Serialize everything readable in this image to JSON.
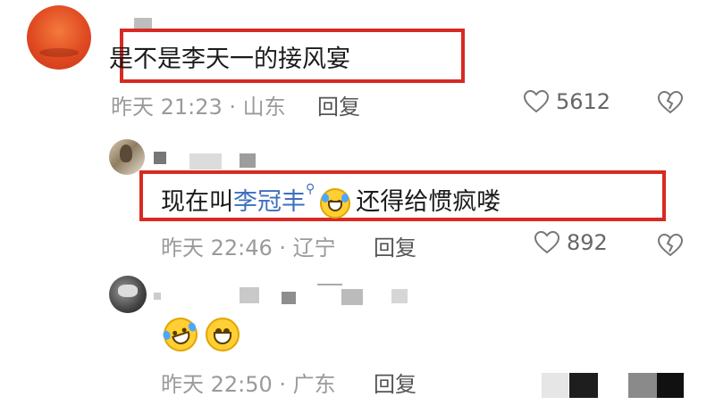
{
  "comments": [
    {
      "text": "是不是李天一的接风宴",
      "meta": "昨天 21:23 · 山东",
      "reply_label": "回复",
      "likes": "5612"
    },
    {
      "text_before": "现在叫",
      "mention": "李冠丰",
      "text_after": "还得给惯疯喽",
      "meta": "昨天 22:46 · 辽宁",
      "reply_label": "回复",
      "likes": "892"
    },
    {
      "emojis": [
        "laughing-tears",
        "grinning"
      ],
      "meta": "昨天 22:50 · 广东",
      "reply_label": "回复"
    }
  ],
  "colors": {
    "highlight_box": "#d82a22",
    "mention": "#3d6fbf",
    "meta_text": "#9a9a9a"
  },
  "icons": {
    "like": "heart-outline-icon",
    "dislike": "broken-heart-icon",
    "mention_search": "search-icon"
  }
}
